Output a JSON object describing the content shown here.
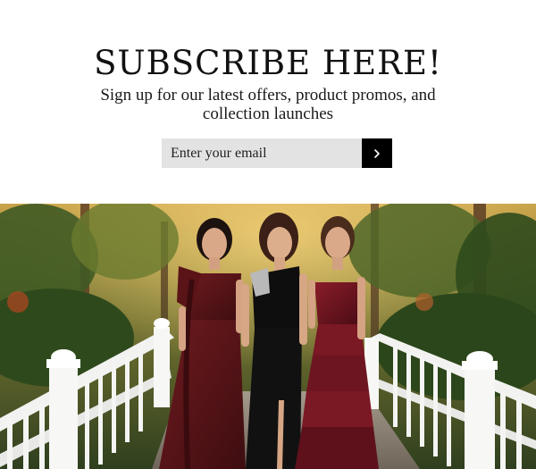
{
  "subscribe": {
    "title": "SUBSCRIBE HERE!",
    "subtitle": "Sign up for our latest offers, product promos, and collection launches",
    "email_placeholder": "Enter your email",
    "submit_icon": "chevron-right-icon"
  },
  "colors": {
    "background": "#ffffff",
    "input_background": "#e3e3e3",
    "button_background": "#000000",
    "burgundy_dress": "#5e1518",
    "black_dress": "#0e0e0e",
    "wine_tulle_dress": "#6b1420"
  }
}
